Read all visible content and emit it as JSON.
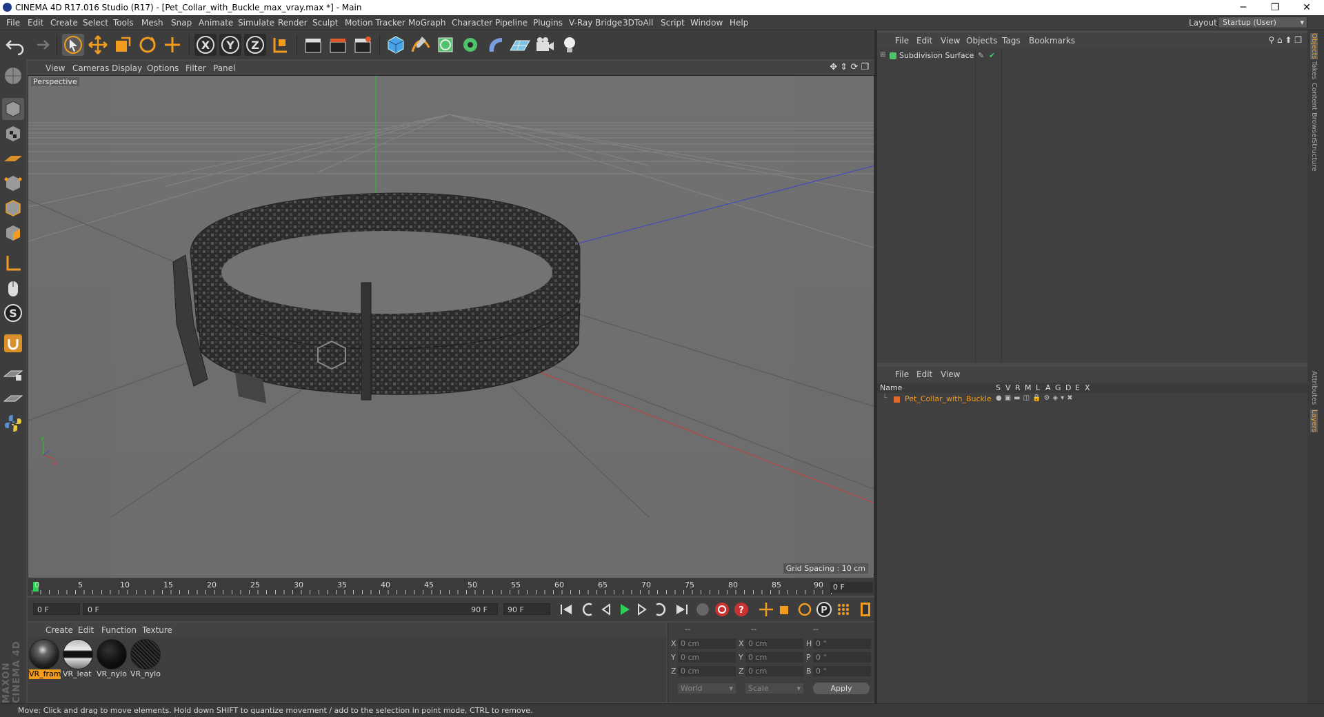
{
  "window": {
    "title": "CINEMA 4D R17.016 Studio (R17) - [Pet_Collar_with_Buckle_max_vray.max *] - Main",
    "controls": [
      "─",
      "❐",
      "✕"
    ]
  },
  "menubar": {
    "items": [
      "File",
      "Edit",
      "Create",
      "Select",
      "Tools",
      "Mesh",
      "Snap",
      "Animate",
      "Simulate",
      "Render",
      "Sculpt",
      "Motion Tracker",
      "MoGraph",
      "Character",
      "Pipeline",
      "Plugins",
      "V-Ray Bridge",
      "3DToAll",
      "Script",
      "Window",
      "Help"
    ],
    "layout_label": "Layout:",
    "layout_value": "Startup (User)"
  },
  "viewport": {
    "menu": [
      "View",
      "Cameras",
      "Display",
      "Options",
      "Filter",
      "Panel"
    ],
    "label": "Perspective",
    "grid_spacing": "Grid Spacing : 10 cm"
  },
  "timeline": {
    "ticks": [
      "0",
      "5",
      "10",
      "15",
      "20",
      "25",
      "30",
      "35",
      "40",
      "45",
      "50",
      "55",
      "60",
      "65",
      "70",
      "75",
      "80",
      "85",
      "90"
    ],
    "end_field": "0 F"
  },
  "transport": {
    "current_frame": "0 F",
    "range_start": "0 F",
    "range_end": "90 F",
    "max_frame": "90 F"
  },
  "material_manager": {
    "menu": [
      "Create",
      "Edit",
      "Function",
      "Texture"
    ],
    "materials": [
      "VR_fram",
      "VR_leat",
      "VR_nylo",
      "VR_nylo"
    ]
  },
  "coordinates": {
    "headers": [
      "--",
      "--",
      "--"
    ],
    "rows": [
      {
        "a": "X",
        "av": "0 cm",
        "b": "X",
        "bv": "0 cm",
        "c": "H",
        "cv": "0 °"
      },
      {
        "a": "Y",
        "av": "0 cm",
        "b": "Y",
        "bv": "0 cm",
        "c": "P",
        "cv": "0 °"
      },
      {
        "a": "Z",
        "av": "0 cm",
        "b": "Z",
        "bv": "0 cm",
        "c": "B",
        "cv": "0 °"
      }
    ],
    "mode1": "World",
    "mode2": "Scale",
    "apply": "Apply"
  },
  "object_manager": {
    "menu": [
      "File",
      "Edit",
      "View",
      "Objects",
      "Tags",
      "Bookmarks"
    ],
    "object": "Subdivision Surface"
  },
  "layer_manager": {
    "menu": [
      "File",
      "Edit",
      "View"
    ],
    "header_name": "Name",
    "columns": [
      "S",
      "V",
      "R",
      "M",
      "L",
      "A",
      "G",
      "D",
      "E",
      "X"
    ],
    "layer": "Pet_Collar_with_Buckle"
  },
  "side_tabs": [
    "Objects",
    "Takes",
    "Content Browser",
    "Structure",
    "Attributes",
    "Layers"
  ],
  "statusbar": "Move: Click and drag to move elements. Hold down SHIFT to quantize movement / add to the selection in point mode, CTRL to remove.",
  "brand": "MAXON CINEMA 4D",
  "colors": {
    "accent": "#f29c1f",
    "axis_x": "#c83c3c",
    "axis_y": "#3cb43c",
    "axis_z": "#4050d0"
  }
}
